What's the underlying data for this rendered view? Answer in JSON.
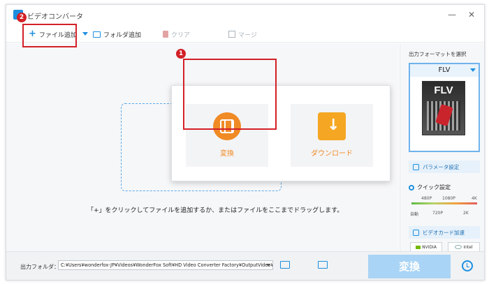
{
  "app": {
    "title": "ビデオコンバータ"
  },
  "window_controls": {
    "minimize": "—",
    "close": "✕"
  },
  "toolbar": {
    "add_file": "ファイル追加",
    "add_folder": "フォルダ追加",
    "clear": "クリア",
    "merge": "マージ"
  },
  "popup": {
    "convert_label": "変換",
    "download_label": "ダウンロード"
  },
  "main": {
    "drop_plus": "+",
    "hint": "「+」をクリックしてファイルを追加するか、またはファイルをここまでドラッグします。"
  },
  "right_panel": {
    "title": "出力フォーマットを選択",
    "format": "FLV",
    "format_art_text": "FLV",
    "params_button": "パラメータ設定",
    "quick_label": "クイック設定",
    "quality_top": [
      "480P",
      "1080P",
      "4K"
    ],
    "quality_bottom": [
      "自動",
      "720P",
      "2K"
    ],
    "gpu_button": "ビデオカード加速",
    "gpu_nvidia": "NVIDIA",
    "gpu_intel": "Intel"
  },
  "bottom": {
    "output_label": "出力フォルダ：",
    "output_path": "C:¥Users¥wonderfox-JP¥Videos¥WonderFox Soft¥HD Video Converter Factory¥OutputVideo¥",
    "convert_button": "変換"
  },
  "markers": {
    "badge_1": "1",
    "badge_2": "2"
  },
  "colors": {
    "accent": "#1d8fe0",
    "orange": "#f08a24",
    "marker_red": "#d32027",
    "convert_disabled": "#a9d4f5"
  }
}
